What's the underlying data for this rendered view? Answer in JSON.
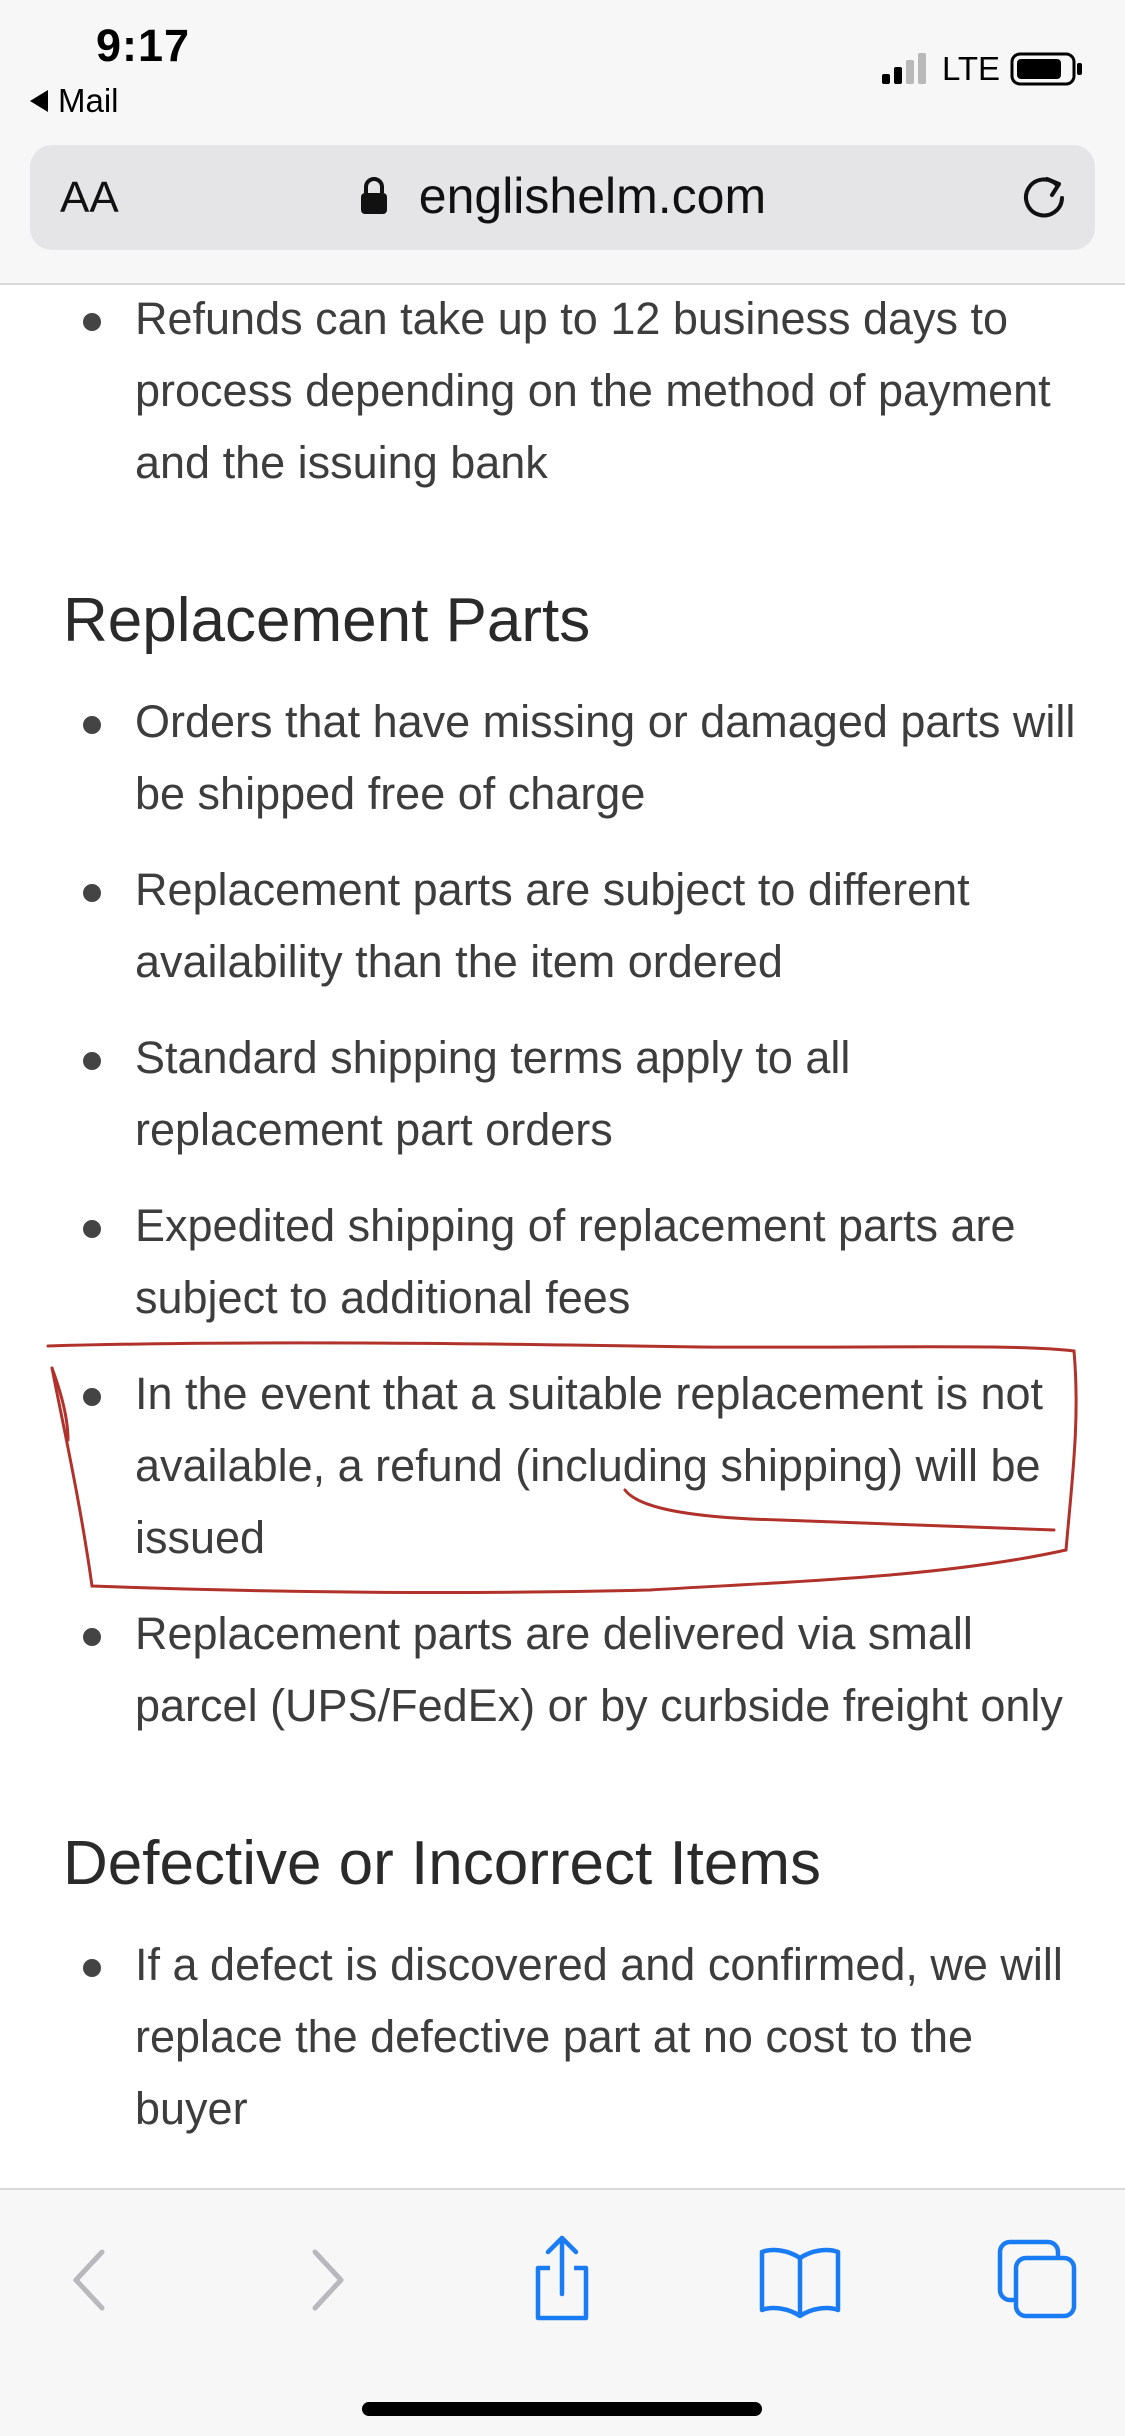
{
  "status_bar": {
    "time": "9:17",
    "back_app": "Mail",
    "network": "LTE"
  },
  "browser": {
    "reader_label": "AA",
    "domain": "englishelm.com"
  },
  "content": {
    "intro_bullets": [
      "Refunds can take up to 12 business days to process depending on the method of payment and the issuing bank"
    ],
    "sections": [
      {
        "heading": "Replacement Parts",
        "bullets": [
          "Orders that have missing or damaged parts will be shipped free of charge",
          "Replacement parts are subject to different availability than the item ordered",
          "Standard shipping terms apply to all replacement part orders",
          "Expedited shipping of replacement parts are subject to additional fees",
          "In the event that a suitable replacement is not available, a refund (including shipping) will be issued",
          "Replacement parts are delivered via small parcel (UPS/FedEx) or by curbside freight only"
        ]
      },
      {
        "heading": "Defective or Incorrect Items",
        "bullets": [
          "If a defect is discovered and confirmed, we will replace the defective part at no cost to the buyer"
        ]
      }
    ]
  },
  "annotation": {
    "color": "#b0322b"
  },
  "toolbar": {
    "icons": [
      "back-icon",
      "forward-icon",
      "share-icon",
      "bookmarks-icon",
      "tabs-icon"
    ],
    "accent": "#1a7cf5",
    "disabled": "#b8b8bd"
  }
}
